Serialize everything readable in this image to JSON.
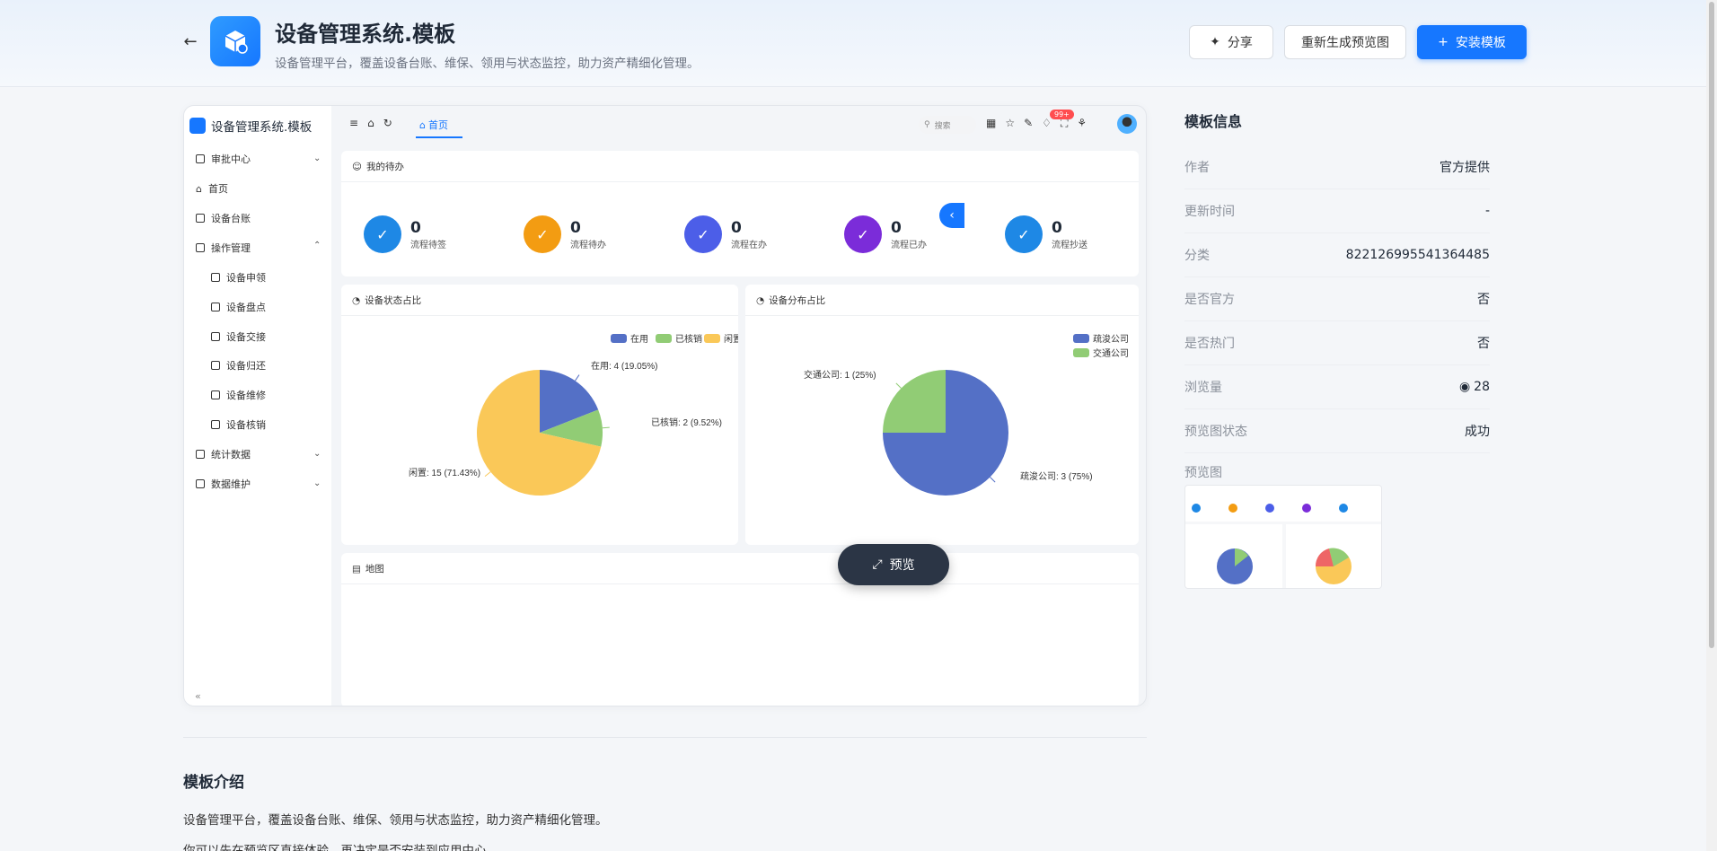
{
  "header": {
    "title": "设备管理系统.模板",
    "subtitle": "设备管理平台，覆盖设备台账、维保、领用与状态监控，助力资产精细化管理。",
    "share_label": "分享",
    "regen_label": "重新生成预览图",
    "install_label": "安装模板"
  },
  "preview": {
    "app_name": "设备管理系统.模板",
    "menu": [
      {
        "label": "审批中心"
      },
      {
        "label": "首页"
      },
      {
        "label": "设备台账"
      },
      {
        "label": "操作管理"
      },
      {
        "label": "设备申领"
      },
      {
        "label": "设备盘点"
      },
      {
        "label": "设备交接"
      },
      {
        "label": "设备归还"
      },
      {
        "label": "设备维修"
      },
      {
        "label": "设备核销"
      },
      {
        "label": "统计数据"
      },
      {
        "label": "数据维护"
      }
    ],
    "tab_home": "首页",
    "search_placeholder": "搜索",
    "notif_badge": "99+",
    "todo_title": "我的待办",
    "todos": [
      {
        "value": "0",
        "label": "流程待签",
        "color": "#1e88e5"
      },
      {
        "value": "0",
        "label": "流程待办",
        "color": "#f39c12"
      },
      {
        "value": "0",
        "label": "流程在办",
        "color": "#4c5ee8"
      },
      {
        "value": "0",
        "label": "流程已办",
        "color": "#7b2cd9"
      },
      {
        "value": "0",
        "label": "流程抄送",
        "color": "#1e88e5"
      }
    ],
    "status_title": "设备状态占比",
    "distribution_title": "设备分布占比",
    "map_title": "地图",
    "preview_button": "预览"
  },
  "chart_data": [
    {
      "type": "pie",
      "title": "设备状态占比",
      "categories": [
        "在用",
        "已核销",
        "闲置"
      ],
      "values": [
        4,
        2,
        15
      ],
      "labels": [
        "在用: 4 (19.05%)",
        "已核销: 2 (9.52%)",
        "闲置: 15 (71.43%)"
      ],
      "colors": [
        "#5470c6",
        "#91cc75",
        "#fac858"
      ],
      "legend": "top-right"
    },
    {
      "type": "pie",
      "title": "设备分布占比",
      "categories": [
        "疏浚公司",
        "交通公司"
      ],
      "values": [
        3,
        1
      ],
      "labels": [
        "疏浚公司: 3 (75%)",
        "交通公司: 1 (25%)"
      ],
      "colors": [
        "#5470c6",
        "#91cc75"
      ],
      "legend": "top-right"
    }
  ],
  "info": {
    "title": "模板信息",
    "rows": [
      {
        "key": "作者",
        "value": "官方提供"
      },
      {
        "key": "更新时间",
        "value": "-"
      },
      {
        "key": "分类",
        "value": "822126995541364485"
      },
      {
        "key": "是否官方",
        "value": "否"
      },
      {
        "key": "是否热门",
        "value": "否"
      },
      {
        "key": "浏览量",
        "value": "28"
      },
      {
        "key": "预览图状态",
        "value": "成功"
      }
    ],
    "thumb_label": "预览图"
  },
  "intro": {
    "title": "模板介绍",
    "p1": "设备管理平台，覆盖设备台账、维保、领用与状态监控，助力资产精细化管理。",
    "p2": "你可以先在预览区直接体验，再决定是否安装到应用中心。"
  }
}
